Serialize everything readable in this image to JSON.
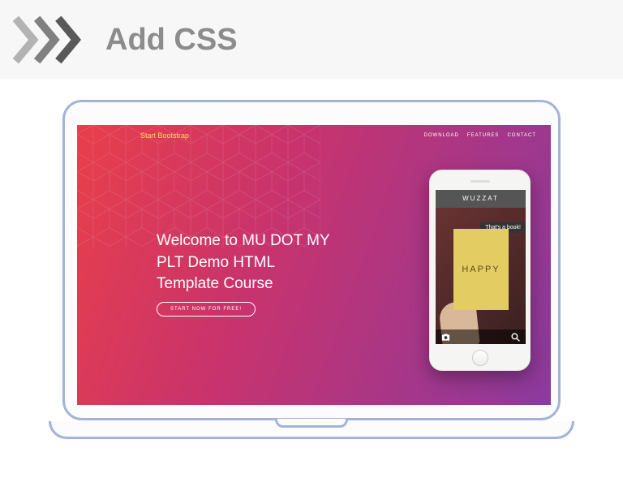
{
  "header": {
    "title": "Add CSS"
  },
  "site": {
    "brand": "Start Bootstrap",
    "nav": [
      "DOWNLOAD",
      "FEATURES",
      "CONTACT"
    ],
    "headline": "Welcome to MU DOT MY PLT Demo HTML Template Course",
    "cta": "START NOW FOR FREE!"
  },
  "phone": {
    "app_title": "WUZZAT",
    "tooltip": "That's a book!",
    "book_title": "HAPPY"
  }
}
